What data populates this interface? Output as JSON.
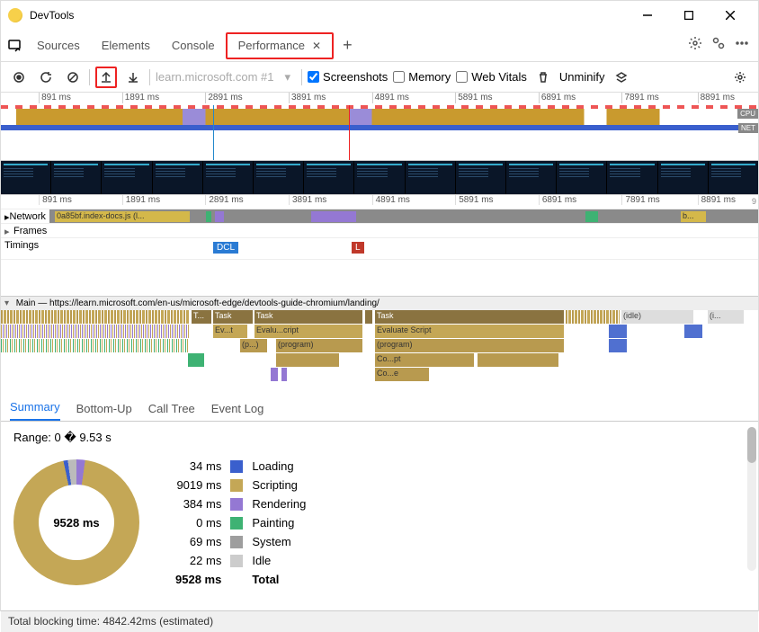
{
  "window": {
    "title": "DevTools"
  },
  "tabs": {
    "items": [
      "Sources",
      "Elements",
      "Console",
      "Performance"
    ],
    "active_index": 3
  },
  "toolbar": {
    "url": "learn.microsoft.com #1",
    "checkboxes": {
      "screenshots": {
        "label": "Screenshots",
        "checked": true
      },
      "memory": {
        "label": "Memory",
        "checked": false
      },
      "web_vitals": {
        "label": "Web Vitals",
        "checked": false
      }
    },
    "unminify": "Unminify"
  },
  "timeline": {
    "ticks": [
      "891 ms",
      "1891 ms",
      "2891 ms",
      "3891 ms",
      "4891 ms",
      "5891 ms",
      "6891 ms",
      "7891 ms",
      "8891 ms"
    ],
    "cpu_label": "CPU",
    "net_label": "NET"
  },
  "tracks": {
    "network": {
      "label": "Network",
      "sample_bar": "0a85bf.index-docs.js (l...",
      "sample_bar2": "b..."
    },
    "frames": {
      "label": "Frames"
    },
    "timings": {
      "label": "Timings",
      "dcl": "DCL",
      "l": "L"
    },
    "main": {
      "label": "Main — https://learn.microsoft.com/en-us/microsoft-edge/devtools-guide-chromium/landing/",
      "bars": {
        "task": "Task",
        "t_short": "T...",
        "evt": "Ev...t",
        "prog_short": "(p...)",
        "eval": "Evalu...cript",
        "program": "(program)",
        "evaluate": "Evaluate Script",
        "co1": "Co...pt",
        "co2": "Co...e",
        "idle": "(idle)",
        "i_short": "(i..."
      }
    }
  },
  "bottom_tabs": [
    "Summary",
    "Bottom-Up",
    "Call Tree",
    "Event Log"
  ],
  "summary": {
    "range": "Range: 0 � 9.53 s",
    "total_center": "9528 ms",
    "rows": [
      {
        "ms": "34 ms",
        "color": "#3a5fcd",
        "label": "Loading"
      },
      {
        "ms": "9019 ms",
        "color": "#c4a756",
        "label": "Scripting"
      },
      {
        "ms": "384 ms",
        "color": "#9478d3",
        "label": "Rendering"
      },
      {
        "ms": "0 ms",
        "color": "#3eb273",
        "label": "Painting"
      },
      {
        "ms": "69 ms",
        "color": "#9e9e9e",
        "label": "System"
      },
      {
        "ms": "22 ms",
        "color": "#cccccc",
        "label": "Idle"
      }
    ],
    "total": {
      "ms": "9528 ms",
      "label": "Total"
    }
  },
  "status": "Total blocking time: 4842.42ms (estimated)",
  "chart_data": {
    "type": "pie",
    "title": "Time breakdown",
    "categories": [
      "Loading",
      "Scripting",
      "Rendering",
      "Painting",
      "System",
      "Idle"
    ],
    "values": [
      34,
      9019,
      384,
      0,
      69,
      22
    ],
    "total": 9528,
    "unit": "ms"
  }
}
